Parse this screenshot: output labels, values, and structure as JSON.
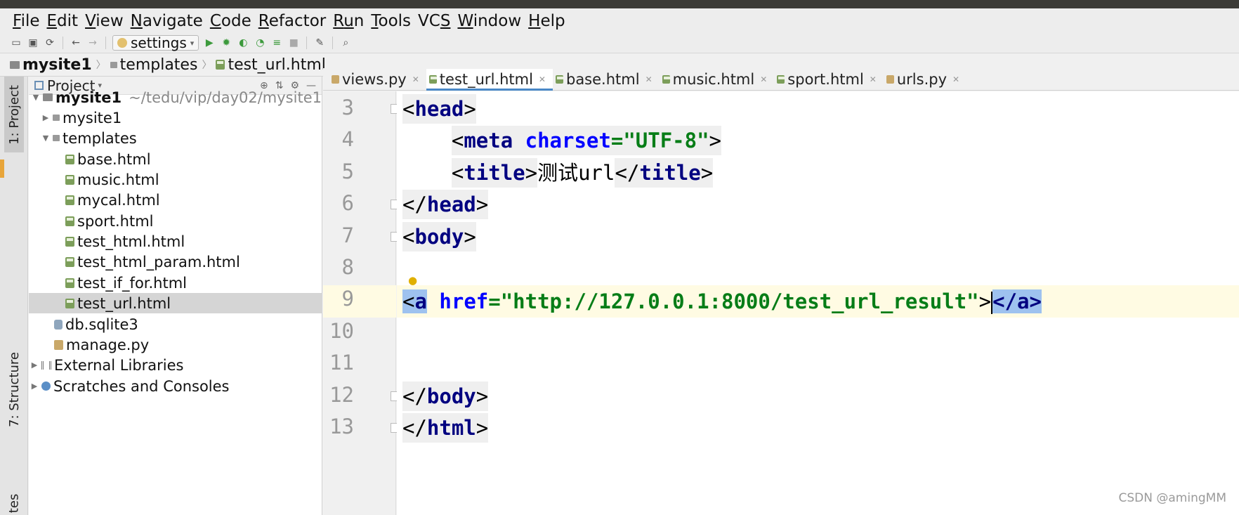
{
  "menu": {
    "items": [
      {
        "mn": "F",
        "rest": "ile"
      },
      {
        "mn": "E",
        "rest": "dit"
      },
      {
        "mn": "V",
        "rest": "iew"
      },
      {
        "mn": "N",
        "rest": "avigate"
      },
      {
        "mn": "C",
        "rest": "ode"
      },
      {
        "mn": "R",
        "rest": "efactor"
      },
      {
        "mn": "R",
        "rest": "u",
        "tail": "n"
      },
      {
        "mn": "T",
        "rest": "ools"
      },
      {
        "mn": "",
        "rest": "VC",
        "tailmn": "S"
      },
      {
        "mn": "W",
        "rest": "indow"
      },
      {
        "mn": "H",
        "rest": "elp"
      }
    ]
  },
  "toolbar": {
    "run_config": "settings",
    "icons": [
      "open-icon",
      "save-icon",
      "sync-icon",
      "back-icon",
      "forward-icon",
      "run-icon",
      "debug-icon",
      "coverage-icon",
      "profile-icon",
      "concurrency-icon",
      "stop-icon",
      "settings-wrench-icon",
      "search-icon"
    ]
  },
  "breadcrumbs": [
    "mysite1",
    "templates",
    "test_url.html"
  ],
  "sidebar": {
    "vtab_project": "1: Project",
    "vtab_structure": "7: Structure",
    "vtab_bottom": "tes"
  },
  "project_panel": {
    "title": "Project",
    "tree": [
      {
        "label": "mysite1",
        "path": "~/tedu/vip/day02/mysite1"
      },
      {
        "label": "mysite1"
      },
      {
        "label": "templates"
      },
      {
        "label": "base.html"
      },
      {
        "label": "music.html"
      },
      {
        "label": "mycal.html"
      },
      {
        "label": "sport.html"
      },
      {
        "label": "test_html.html"
      },
      {
        "label": "test_html_param.html"
      },
      {
        "label": "test_if_for.html"
      },
      {
        "label": "test_url.html"
      },
      {
        "label": "db.sqlite3"
      },
      {
        "label": "manage.py"
      },
      {
        "label": "External Libraries"
      },
      {
        "label": "Scratches and Consoles"
      }
    ]
  },
  "editor": {
    "tabs": [
      "views.py",
      "test_url.html",
      "base.html",
      "music.html",
      "sport.html",
      "urls.py"
    ],
    "active_tab": "test_url.html",
    "line_numbers": [
      "3",
      "4",
      "5",
      "6",
      "7",
      "8",
      "9",
      "10",
      "11",
      "12",
      "13"
    ],
    "code": {
      "l3_open": "<",
      "l3_tag": "head",
      "l3_close": ">",
      "l4_indent": "    ",
      "l4_open": "<",
      "l4_tag": "meta",
      "l4_sp": " ",
      "l4_attr": "charset",
      "l4_eq": "=",
      "l4_val": "\"UTF-8\"",
      "l4_close": ">",
      "l5_indent": "    ",
      "l5_open": "<",
      "l5_tag": "title",
      "l5_close": ">",
      "l5_text": "测试url",
      "l5_end_open": "</",
      "l5_end_tag": "title",
      "l5_end_close": ">",
      "l6_open": "</",
      "l6_tag": "head",
      "l6_close": ">",
      "l7_open": "<",
      "l7_tag": "body",
      "l7_close": ">",
      "l9_open": "<",
      "l9_tag": "a",
      "l9_sp": " ",
      "l9_attr": "href",
      "l9_eq": "=",
      "l9_val": "\"http://127.0.0.1:8000/test_url_result\"",
      "l9_gt": ">",
      "l9_end": "</a>",
      "l12_open": "</",
      "l12_tag": "body",
      "l12_close": ">",
      "l13_open": "</",
      "l13_tag": "html",
      "l13_close": ">"
    }
  },
  "watermark": "CSDN @amingMM",
  "colors": {
    "tag": "#000080",
    "attribute": "#0000ff",
    "string": "#067d17",
    "current_line": "#fffbe3",
    "selection": "#9ec2ef"
  }
}
